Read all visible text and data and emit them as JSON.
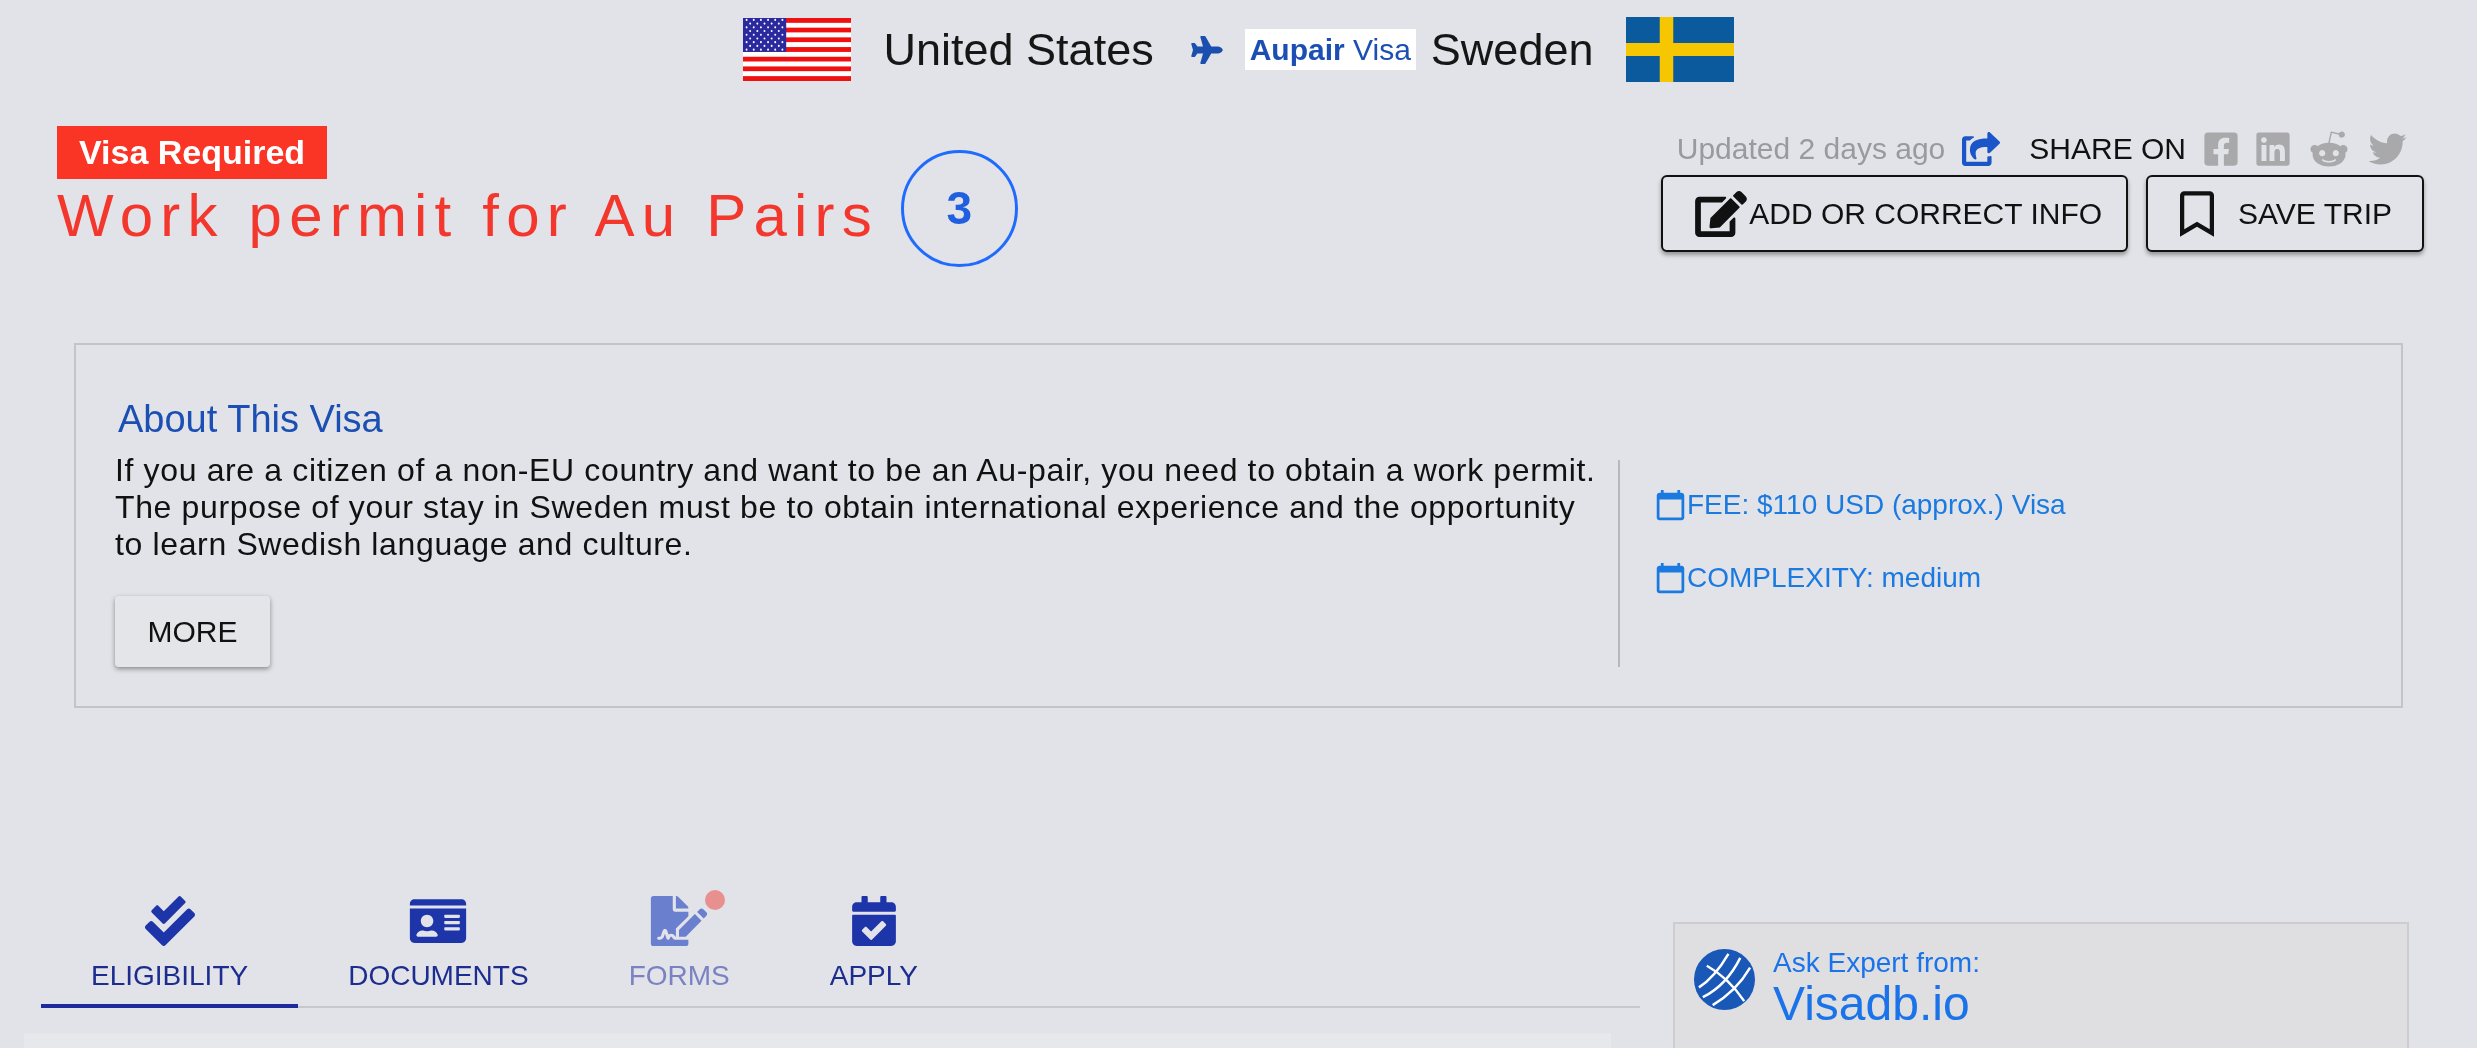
{
  "route": {
    "origin": "United States",
    "visa_type": "**Aupair** Visa",
    "destination": "Sweden"
  },
  "visa": {
    "status": "Visa Required",
    "title": "Work permit for Au Pairs",
    "count": "3"
  },
  "meta": {
    "updated": "Updated 2 days ago",
    "share_label": "SHARE ON"
  },
  "actions": [
    {
      "label": "ADD OR CORRECT INFO"
    },
    {
      "label": "SAVE TRIP"
    }
  ],
  "about": {
    "heading": "About This Visa",
    "text": "If you are a citizen of a non-EU country and want to be an Au-pair, you need to obtain a work permit. The purpose of your stay in Sweden must be to obtain international experience and the opportunity to learn Swedish language and culture.",
    "button": "MORE",
    "facts": [
      {
        "text": "FEE: $110 USD (approx.) Visa"
      },
      {
        "text": "COMPLEXITY: medium"
      }
    ]
  },
  "tabs": [
    {
      "label": "ELIGIBILITY",
      "selected": true,
      "disabled": false,
      "notification_dot": false
    },
    {
      "label": "DOCUMENTS",
      "selected": false,
      "disabled": false,
      "notification_dot": false
    },
    {
      "label": "FORMS",
      "selected": false,
      "disabled": true,
      "notification_dot": true
    },
    {
      "label": "APPLY",
      "selected": false,
      "disabled": false,
      "notification_dot": false
    }
  ],
  "expert": {
    "prompt": "Ask Expert from:",
    "brand": "Visadb.io"
  }
}
